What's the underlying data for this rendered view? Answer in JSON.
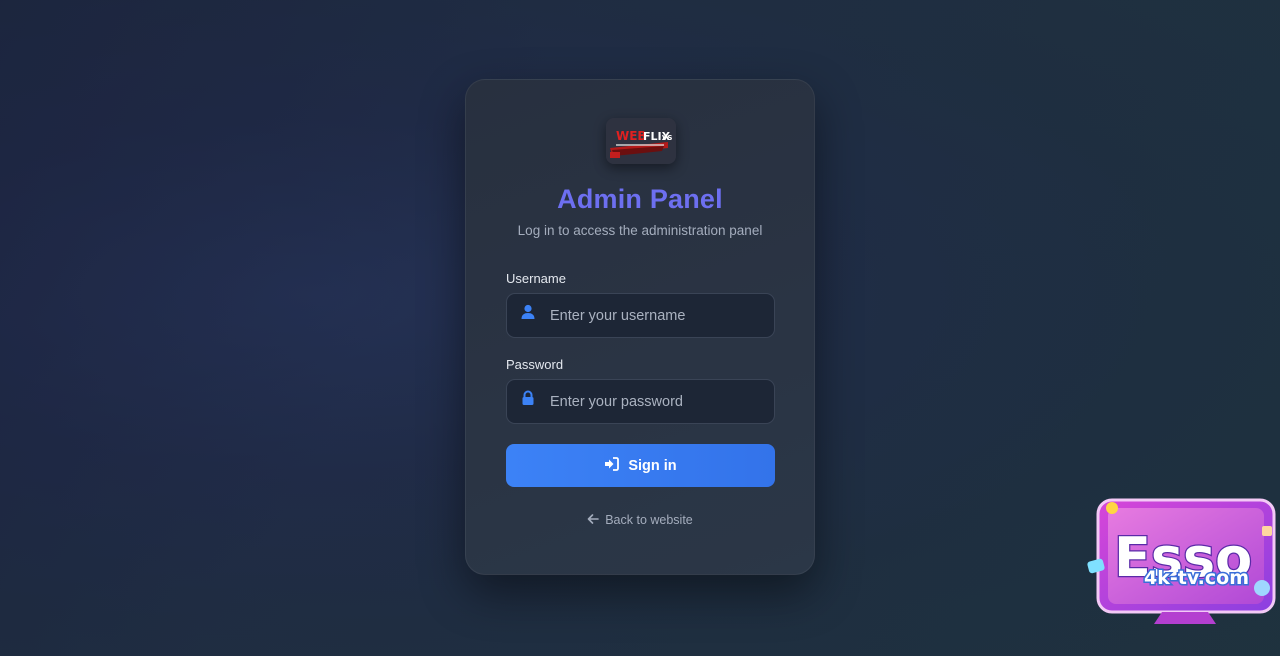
{
  "logo": {
    "text_top": "WEB",
    "text_top2": "FLIX",
    "text_suffix": "VS",
    "icon": "logo-image"
  },
  "login": {
    "title": "Admin Panel",
    "subtitle": "Log in to access the administration panel",
    "username": {
      "label": "Username",
      "placeholder": "Enter your username",
      "value": "",
      "icon": "user-icon"
    },
    "password": {
      "label": "Password",
      "placeholder": "Enter your password",
      "value": "",
      "icon": "lock-icon"
    },
    "signin_label": "Sign in",
    "signin_icon": "sign-in-icon",
    "back_label": "Back to website",
    "back_icon": "arrow-left-icon"
  },
  "watermark": {
    "brand": "Esso",
    "domain": "4k-tv.com"
  },
  "colors": {
    "accent": "#3c82f6",
    "title": "#6d6ff0",
    "field_bg": "#1d2636",
    "card_bg": "#28303f"
  }
}
